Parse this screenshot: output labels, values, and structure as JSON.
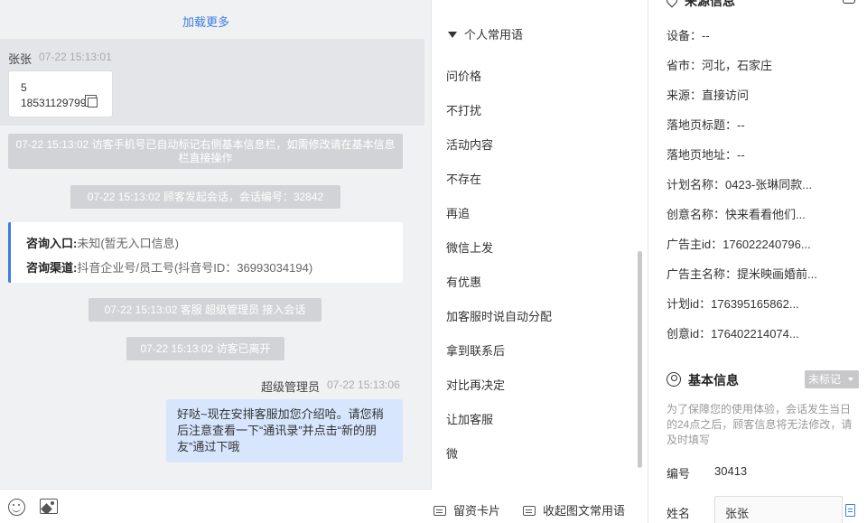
{
  "chat": {
    "load_more": "加载更多",
    "customer_msg": {
      "name": "张张",
      "time": "07-22 15:13:01",
      "line1": "5",
      "line2": "18531129799"
    },
    "system_messages": [
      "07-22 15:13:02 访客手机号已自动标记右侧基本信息栏，如需修改请在基本信息栏直接操作",
      "07-22 15:13:02 顾客发起会话，会话编号：32842",
      "07-22 15:13:02 客服 超级管理员 接入会话",
      "07-22 15:13:02 访客已离开"
    ],
    "consult": {
      "entry_label": "咨询入口:",
      "entry_value": "未知(暂无入口信息)",
      "channel_label": "咨询渠道:",
      "channel_value": "抖音企业号/员工号(抖音号ID：36993034194)"
    },
    "agent_msg": {
      "name": "超级管理员",
      "time": "07-22 15:13:06",
      "text": "好哒~现在安排客服加您介绍哈。请您稍后注意查看一下“通讯录”并点击“新的朋友”通过下哦"
    }
  },
  "phrases": {
    "header": "个人常用语",
    "items": [
      "问价格",
      "不打扰",
      "活动内容",
      "不存在",
      "再追",
      "微信上发",
      "有优惠",
      "加客服时说自动分配",
      "拿到联系后",
      "对比再决定",
      "让加客服",
      "微"
    ],
    "footer": {
      "card_label": "留资卡片",
      "collect_label": "收起图文常用语"
    }
  },
  "side": {
    "source_header": "来源信息",
    "source_rows": [
      {
        "label": "设备：",
        "value": "--"
      },
      {
        "label": "省市：",
        "value": "河北，石家庄"
      },
      {
        "label": "来源：",
        "value": "直接访问"
      },
      {
        "label": "落地页标题：",
        "value": "--"
      },
      {
        "label": "落地页地址：",
        "value": "--"
      },
      {
        "label": "计划名称：",
        "value": "0423-张琳同款..."
      },
      {
        "label": "创意名称：",
        "value": "快来看看他们..."
      },
      {
        "label": "广告主id：",
        "value": "176022240796..."
      },
      {
        "label": "广告主名称：",
        "value": "提米映画婚前..."
      },
      {
        "label": "计划id：",
        "value": "176395165862..."
      },
      {
        "label": "创意id：",
        "value": "176402214074..."
      }
    ],
    "basic_header": "基本信息",
    "tag_badge": "未标记",
    "note": "为了保障您的使用体验，会话发生当日的24点之后，顾客信息将无法修改，请及时填写",
    "number_label": "编号",
    "number_value": "30413",
    "name_label": "姓名",
    "name_value": "张张"
  }
}
